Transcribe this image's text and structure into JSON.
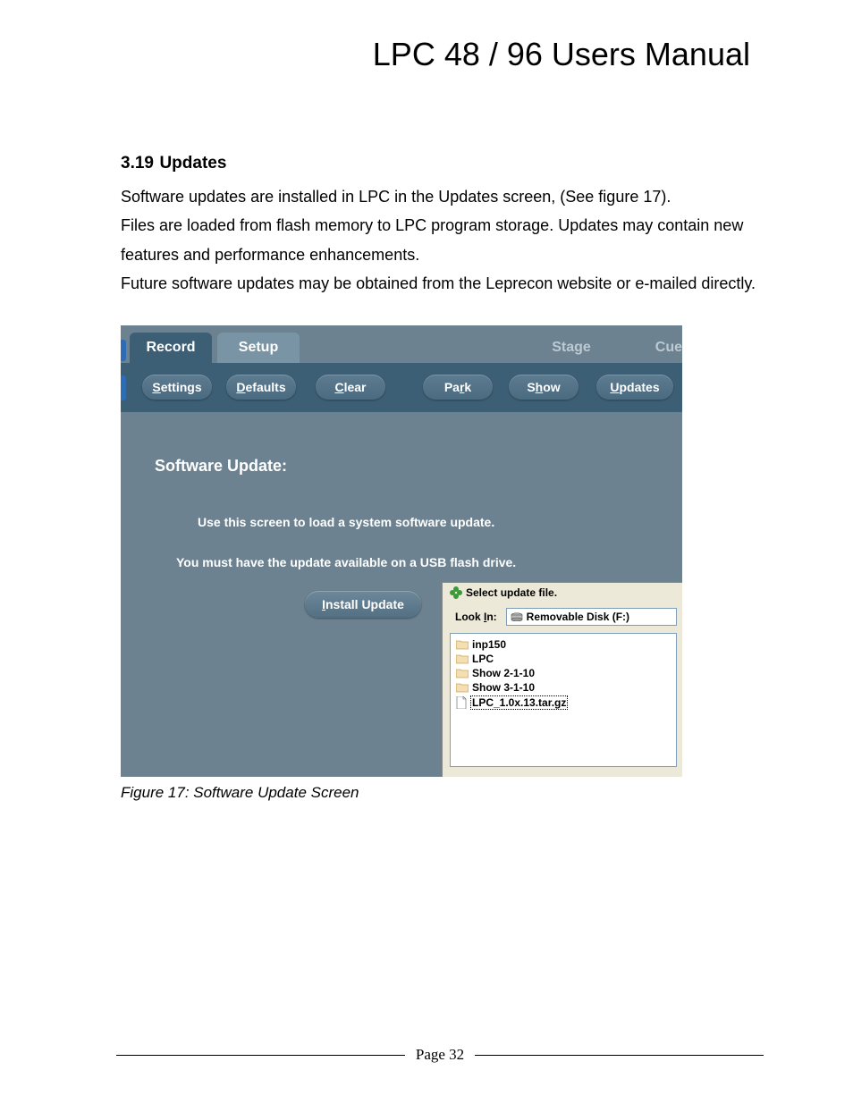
{
  "doc": {
    "title": "LPC 48 / 96 Users Manual",
    "section_number": "3.19",
    "section_title": "Updates",
    "para1": "Software updates are installed in LPC in the Updates screen, (See figure 17).",
    "para2": "Files are loaded from flash memory to LPC program storage. Updates may contain new features and performance enhancements.",
    "para3": "Future software updates may be obtained from the Leprecon website or e-mailed directly.",
    "figure_caption": "Figure 17: Software Update Screen",
    "page_label": "Page 32"
  },
  "screenshot": {
    "top_tabs": {
      "record": "Record",
      "setup": "Setup",
      "stage": "Stage",
      "cue": "Cue"
    },
    "sub_tabs": {
      "settings": "Settings",
      "defaults": "Defaults",
      "clear": "Clear",
      "park": "Park",
      "show": "Show",
      "updates": "Updates"
    },
    "panel": {
      "title": "Software Update:",
      "line1": "Use this screen to load a system software update.",
      "line2": "You must have the update available on a USB flash drive.",
      "install_button": "Install Update"
    },
    "file_dialog": {
      "title": "Select update file.",
      "lookin_label": "Look In:",
      "lookin_value": "Removable Disk (F:)",
      "items": [
        {
          "type": "folder",
          "name": "inp150"
        },
        {
          "type": "folder",
          "name": "LPC"
        },
        {
          "type": "folder",
          "name": "Show 2-1-10"
        },
        {
          "type": "folder",
          "name": "Show 3-1-10"
        },
        {
          "type": "file",
          "name": "LPC_1.0x.13.tar.gz",
          "selected": true
        }
      ]
    }
  }
}
